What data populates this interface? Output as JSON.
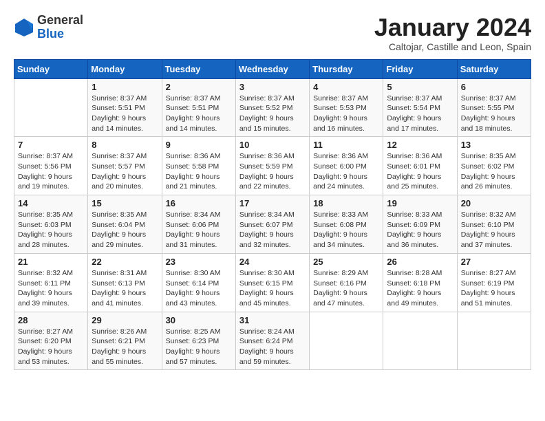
{
  "header": {
    "logo_line1": "General",
    "logo_line2": "Blue",
    "month_year": "January 2024",
    "location": "Caltojar, Castille and Leon, Spain"
  },
  "weekdays": [
    "Sunday",
    "Monday",
    "Tuesday",
    "Wednesday",
    "Thursday",
    "Friday",
    "Saturday"
  ],
  "weeks": [
    [
      {
        "day": "",
        "info": ""
      },
      {
        "day": "1",
        "info": "Sunrise: 8:37 AM\nSunset: 5:51 PM\nDaylight: 9 hours\nand 14 minutes."
      },
      {
        "day": "2",
        "info": "Sunrise: 8:37 AM\nSunset: 5:51 PM\nDaylight: 9 hours\nand 14 minutes."
      },
      {
        "day": "3",
        "info": "Sunrise: 8:37 AM\nSunset: 5:52 PM\nDaylight: 9 hours\nand 15 minutes."
      },
      {
        "day": "4",
        "info": "Sunrise: 8:37 AM\nSunset: 5:53 PM\nDaylight: 9 hours\nand 16 minutes."
      },
      {
        "day": "5",
        "info": "Sunrise: 8:37 AM\nSunset: 5:54 PM\nDaylight: 9 hours\nand 17 minutes."
      },
      {
        "day": "6",
        "info": "Sunrise: 8:37 AM\nSunset: 5:55 PM\nDaylight: 9 hours\nand 18 minutes."
      }
    ],
    [
      {
        "day": "7",
        "info": "Sunrise: 8:37 AM\nSunset: 5:56 PM\nDaylight: 9 hours\nand 19 minutes."
      },
      {
        "day": "8",
        "info": "Sunrise: 8:37 AM\nSunset: 5:57 PM\nDaylight: 9 hours\nand 20 minutes."
      },
      {
        "day": "9",
        "info": "Sunrise: 8:36 AM\nSunset: 5:58 PM\nDaylight: 9 hours\nand 21 minutes."
      },
      {
        "day": "10",
        "info": "Sunrise: 8:36 AM\nSunset: 5:59 PM\nDaylight: 9 hours\nand 22 minutes."
      },
      {
        "day": "11",
        "info": "Sunrise: 8:36 AM\nSunset: 6:00 PM\nDaylight: 9 hours\nand 24 minutes."
      },
      {
        "day": "12",
        "info": "Sunrise: 8:36 AM\nSunset: 6:01 PM\nDaylight: 9 hours\nand 25 minutes."
      },
      {
        "day": "13",
        "info": "Sunrise: 8:35 AM\nSunset: 6:02 PM\nDaylight: 9 hours\nand 26 minutes."
      }
    ],
    [
      {
        "day": "14",
        "info": "Sunrise: 8:35 AM\nSunset: 6:03 PM\nDaylight: 9 hours\nand 28 minutes."
      },
      {
        "day": "15",
        "info": "Sunrise: 8:35 AM\nSunset: 6:04 PM\nDaylight: 9 hours\nand 29 minutes."
      },
      {
        "day": "16",
        "info": "Sunrise: 8:34 AM\nSunset: 6:06 PM\nDaylight: 9 hours\nand 31 minutes."
      },
      {
        "day": "17",
        "info": "Sunrise: 8:34 AM\nSunset: 6:07 PM\nDaylight: 9 hours\nand 32 minutes."
      },
      {
        "day": "18",
        "info": "Sunrise: 8:33 AM\nSunset: 6:08 PM\nDaylight: 9 hours\nand 34 minutes."
      },
      {
        "day": "19",
        "info": "Sunrise: 8:33 AM\nSunset: 6:09 PM\nDaylight: 9 hours\nand 36 minutes."
      },
      {
        "day": "20",
        "info": "Sunrise: 8:32 AM\nSunset: 6:10 PM\nDaylight: 9 hours\nand 37 minutes."
      }
    ],
    [
      {
        "day": "21",
        "info": "Sunrise: 8:32 AM\nSunset: 6:11 PM\nDaylight: 9 hours\nand 39 minutes."
      },
      {
        "day": "22",
        "info": "Sunrise: 8:31 AM\nSunset: 6:13 PM\nDaylight: 9 hours\nand 41 minutes."
      },
      {
        "day": "23",
        "info": "Sunrise: 8:30 AM\nSunset: 6:14 PM\nDaylight: 9 hours\nand 43 minutes."
      },
      {
        "day": "24",
        "info": "Sunrise: 8:30 AM\nSunset: 6:15 PM\nDaylight: 9 hours\nand 45 minutes."
      },
      {
        "day": "25",
        "info": "Sunrise: 8:29 AM\nSunset: 6:16 PM\nDaylight: 9 hours\nand 47 minutes."
      },
      {
        "day": "26",
        "info": "Sunrise: 8:28 AM\nSunset: 6:18 PM\nDaylight: 9 hours\nand 49 minutes."
      },
      {
        "day": "27",
        "info": "Sunrise: 8:27 AM\nSunset: 6:19 PM\nDaylight: 9 hours\nand 51 minutes."
      }
    ],
    [
      {
        "day": "28",
        "info": "Sunrise: 8:27 AM\nSunset: 6:20 PM\nDaylight: 9 hours\nand 53 minutes."
      },
      {
        "day": "29",
        "info": "Sunrise: 8:26 AM\nSunset: 6:21 PM\nDaylight: 9 hours\nand 55 minutes."
      },
      {
        "day": "30",
        "info": "Sunrise: 8:25 AM\nSunset: 6:23 PM\nDaylight: 9 hours\nand 57 minutes."
      },
      {
        "day": "31",
        "info": "Sunrise: 8:24 AM\nSunset: 6:24 PM\nDaylight: 9 hours\nand 59 minutes."
      },
      {
        "day": "",
        "info": ""
      },
      {
        "day": "",
        "info": ""
      },
      {
        "day": "",
        "info": ""
      }
    ]
  ]
}
